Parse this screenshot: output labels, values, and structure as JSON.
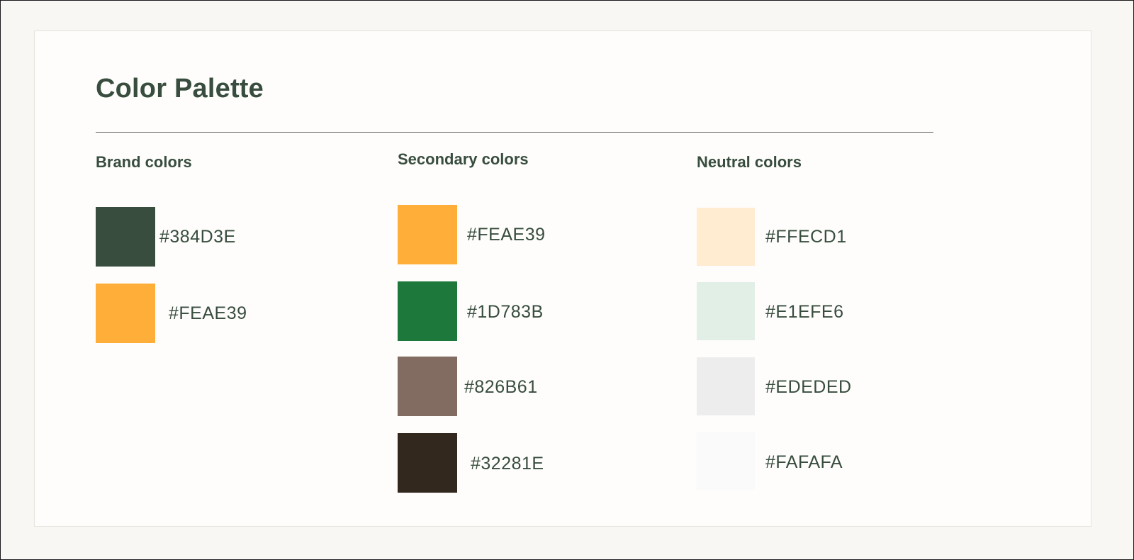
{
  "page": {
    "title": "Color Palette"
  },
  "groups": {
    "brand": {
      "heading": "Brand colors",
      "colors": [
        {
          "hex": "#384D3E",
          "swatch": "#384d3e"
        },
        {
          "hex": "#FEAE39",
          "swatch": "#feae39"
        }
      ]
    },
    "secondary": {
      "heading": "Secondary colors",
      "colors": [
        {
          "hex": "#FEAE39",
          "swatch": "#feae39"
        },
        {
          "hex": "#1D783B",
          "swatch": "#1d783b"
        },
        {
          "hex": "#826B61",
          "swatch": "#826b61"
        },
        {
          "hex": "#32281E",
          "swatch": "#32281e"
        }
      ]
    },
    "neutral": {
      "heading": "Neutral colors",
      "colors": [
        {
          "hex": "#FFECD1",
          "swatch": "#ffecd1"
        },
        {
          "hex": "#E1EFE6",
          "swatch": "#e1efe6"
        },
        {
          "hex": "#EDEDED",
          "swatch": "#ededed"
        },
        {
          "hex": "#FAFAFA",
          "swatch": "#fafafa"
        }
      ]
    }
  }
}
